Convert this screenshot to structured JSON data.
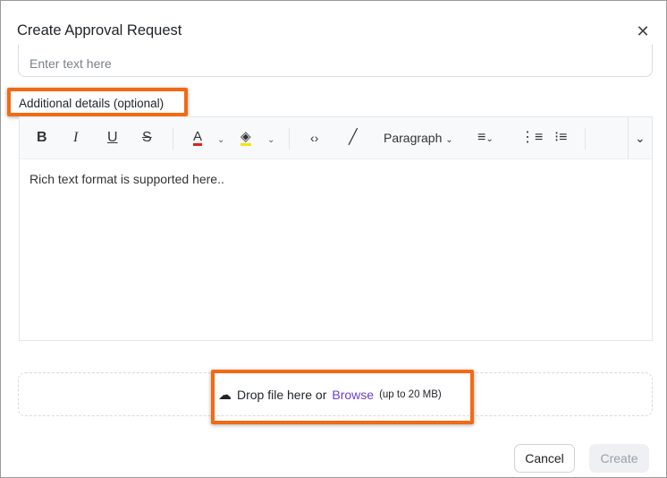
{
  "dialog": {
    "title": "Create Approval Request",
    "close_icon": "close-icon"
  },
  "input": {
    "placeholder": "Enter text here"
  },
  "details": {
    "label": "Additional details (optional)",
    "placeholder": "Rich text format is supported here.."
  },
  "toolbar": {
    "bold": "B",
    "italic": "I",
    "underline": "U",
    "strike": "S",
    "font_color": "A",
    "block_format": "Paragraph",
    "text_color": "#e0201c",
    "highlight_color": "#f5e400"
  },
  "upload": {
    "text": "Drop file here or",
    "browse": "Browse",
    "limit": "(up to 20 MB)"
  },
  "actions": {
    "cancel": "Cancel",
    "create": "Create"
  },
  "highlight_color": "#f26a12"
}
